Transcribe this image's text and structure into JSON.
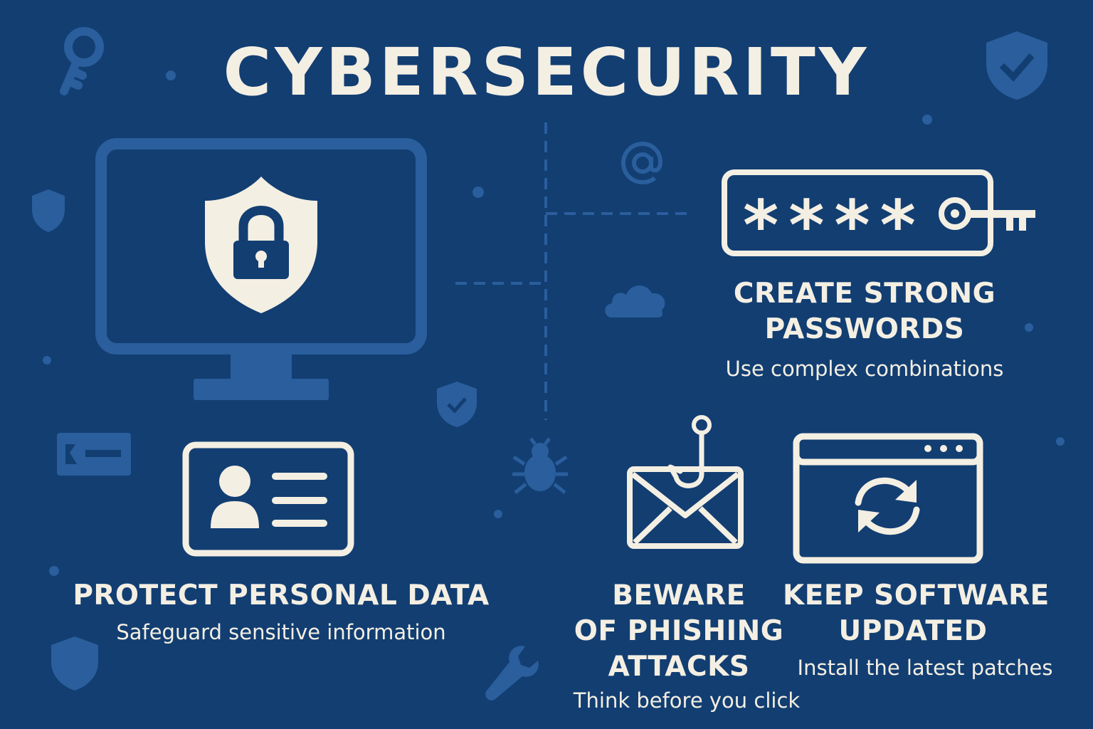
{
  "title": "CYBERSECURITY",
  "password_mask": "****",
  "sections": {
    "passwords": {
      "heading_line1": "CREATE STRONG",
      "heading_line2": "PASSWORDS",
      "subtitle": "Use complex combinations"
    },
    "personal_data": {
      "heading": "PROTECT PERSONAL DATA",
      "subtitle": "Safeguard sensitive information"
    },
    "phishing": {
      "heading_line1": "BEWARE",
      "heading_line2": "OF PHISHING",
      "heading_line3": "ATTACKS",
      "subtitle": "Think before you click"
    },
    "software": {
      "heading_line1": "KEEP SOFTWARE",
      "heading_line2": "UPDATED",
      "subtitle": "Install the latest patches"
    }
  },
  "icons": [
    "monitor-icon",
    "shield-lock-icon",
    "password-field-icon",
    "key-icon",
    "id-card-icon",
    "phishing-email-icon",
    "fish-hook-icon",
    "browser-window-icon",
    "refresh-icon",
    "bug-icon",
    "cloud-icon",
    "at-sign-icon",
    "wrench-icon",
    "shield-check-icon"
  ],
  "colors": {
    "background": "#123e72",
    "foreground": "#f4efe3",
    "accent_faint": "#2a5e9c"
  }
}
